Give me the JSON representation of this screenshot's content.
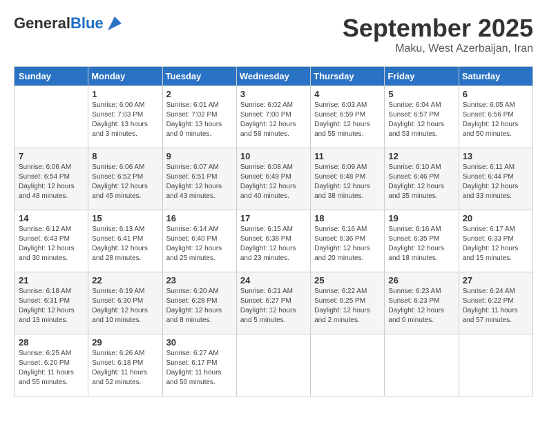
{
  "header": {
    "logo_general": "General",
    "logo_blue": "Blue",
    "month_title": "September 2025",
    "location": "Maku, West Azerbaijan, Iran"
  },
  "days_of_week": [
    "Sunday",
    "Monday",
    "Tuesday",
    "Wednesday",
    "Thursday",
    "Friday",
    "Saturday"
  ],
  "weeks": [
    [
      {
        "day": "",
        "text": ""
      },
      {
        "day": "1",
        "text": "Sunrise: 6:00 AM\nSunset: 7:03 PM\nDaylight: 13 hours\nand 3 minutes."
      },
      {
        "day": "2",
        "text": "Sunrise: 6:01 AM\nSunset: 7:02 PM\nDaylight: 13 hours\nand 0 minutes."
      },
      {
        "day": "3",
        "text": "Sunrise: 6:02 AM\nSunset: 7:00 PM\nDaylight: 12 hours\nand 58 minutes."
      },
      {
        "day": "4",
        "text": "Sunrise: 6:03 AM\nSunset: 6:59 PM\nDaylight: 12 hours\nand 55 minutes."
      },
      {
        "day": "5",
        "text": "Sunrise: 6:04 AM\nSunset: 6:57 PM\nDaylight: 12 hours\nand 53 minutes."
      },
      {
        "day": "6",
        "text": "Sunrise: 6:05 AM\nSunset: 6:56 PM\nDaylight: 12 hours\nand 50 minutes."
      }
    ],
    [
      {
        "day": "7",
        "text": "Sunrise: 6:06 AM\nSunset: 6:54 PM\nDaylight: 12 hours\nand 48 minutes."
      },
      {
        "day": "8",
        "text": "Sunrise: 6:06 AM\nSunset: 6:52 PM\nDaylight: 12 hours\nand 45 minutes."
      },
      {
        "day": "9",
        "text": "Sunrise: 6:07 AM\nSunset: 6:51 PM\nDaylight: 12 hours\nand 43 minutes."
      },
      {
        "day": "10",
        "text": "Sunrise: 6:08 AM\nSunset: 6:49 PM\nDaylight: 12 hours\nand 40 minutes."
      },
      {
        "day": "11",
        "text": "Sunrise: 6:09 AM\nSunset: 6:48 PM\nDaylight: 12 hours\nand 38 minutes."
      },
      {
        "day": "12",
        "text": "Sunrise: 6:10 AM\nSunset: 6:46 PM\nDaylight: 12 hours\nand 35 minutes."
      },
      {
        "day": "13",
        "text": "Sunrise: 6:11 AM\nSunset: 6:44 PM\nDaylight: 12 hours\nand 33 minutes."
      }
    ],
    [
      {
        "day": "14",
        "text": "Sunrise: 6:12 AM\nSunset: 6:43 PM\nDaylight: 12 hours\nand 30 minutes."
      },
      {
        "day": "15",
        "text": "Sunrise: 6:13 AM\nSunset: 6:41 PM\nDaylight: 12 hours\nand 28 minutes."
      },
      {
        "day": "16",
        "text": "Sunrise: 6:14 AM\nSunset: 6:40 PM\nDaylight: 12 hours\nand 25 minutes."
      },
      {
        "day": "17",
        "text": "Sunrise: 6:15 AM\nSunset: 6:38 PM\nDaylight: 12 hours\nand 23 minutes."
      },
      {
        "day": "18",
        "text": "Sunrise: 6:16 AM\nSunset: 6:36 PM\nDaylight: 12 hours\nand 20 minutes."
      },
      {
        "day": "19",
        "text": "Sunrise: 6:16 AM\nSunset: 6:35 PM\nDaylight: 12 hours\nand 18 minutes."
      },
      {
        "day": "20",
        "text": "Sunrise: 6:17 AM\nSunset: 6:33 PM\nDaylight: 12 hours\nand 15 minutes."
      }
    ],
    [
      {
        "day": "21",
        "text": "Sunrise: 6:18 AM\nSunset: 6:31 PM\nDaylight: 12 hours\nand 13 minutes."
      },
      {
        "day": "22",
        "text": "Sunrise: 6:19 AM\nSunset: 6:30 PM\nDaylight: 12 hours\nand 10 minutes."
      },
      {
        "day": "23",
        "text": "Sunrise: 6:20 AM\nSunset: 6:28 PM\nDaylight: 12 hours\nand 8 minutes."
      },
      {
        "day": "24",
        "text": "Sunrise: 6:21 AM\nSunset: 6:27 PM\nDaylight: 12 hours\nand 5 minutes."
      },
      {
        "day": "25",
        "text": "Sunrise: 6:22 AM\nSunset: 6:25 PM\nDaylight: 12 hours\nand 2 minutes."
      },
      {
        "day": "26",
        "text": "Sunrise: 6:23 AM\nSunset: 6:23 PM\nDaylight: 12 hours\nand 0 minutes."
      },
      {
        "day": "27",
        "text": "Sunrise: 6:24 AM\nSunset: 6:22 PM\nDaylight: 11 hours\nand 57 minutes."
      }
    ],
    [
      {
        "day": "28",
        "text": "Sunrise: 6:25 AM\nSunset: 6:20 PM\nDaylight: 11 hours\nand 55 minutes."
      },
      {
        "day": "29",
        "text": "Sunrise: 6:26 AM\nSunset: 6:18 PM\nDaylight: 11 hours\nand 52 minutes."
      },
      {
        "day": "30",
        "text": "Sunrise: 6:27 AM\nSunset: 6:17 PM\nDaylight: 11 hours\nand 50 minutes."
      },
      {
        "day": "",
        "text": ""
      },
      {
        "day": "",
        "text": ""
      },
      {
        "day": "",
        "text": ""
      },
      {
        "day": "",
        "text": ""
      }
    ]
  ]
}
